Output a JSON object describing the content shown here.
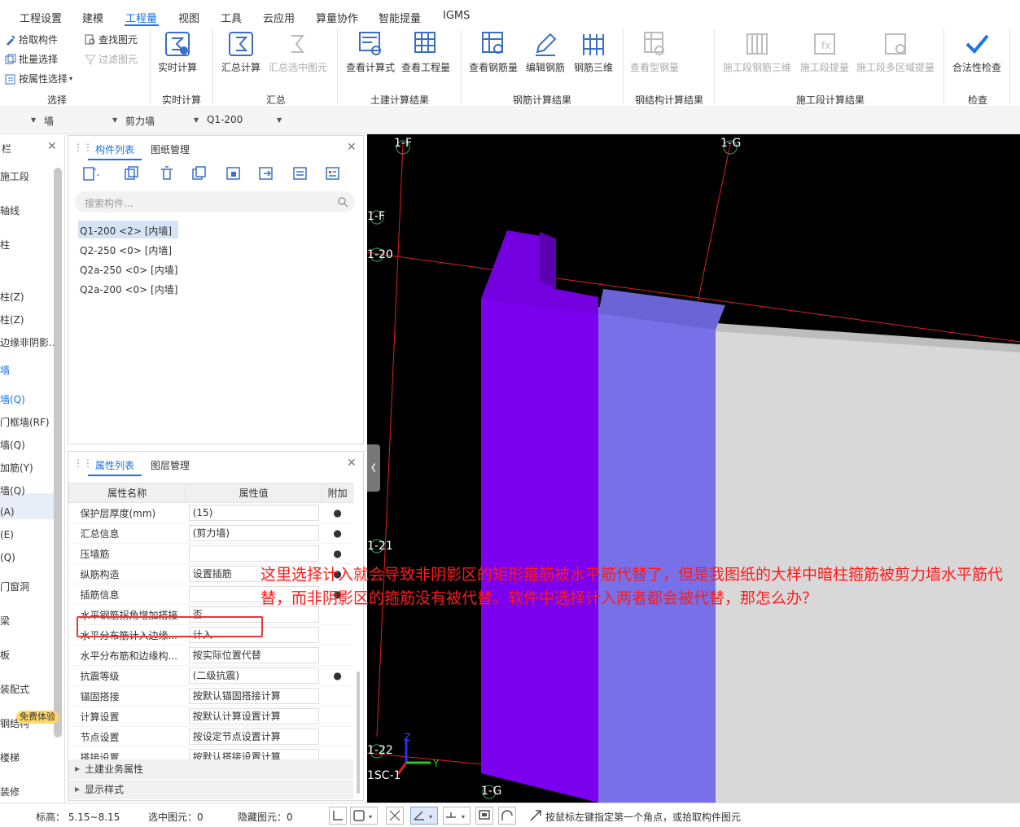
{
  "menu": {
    "items": [
      "工程设置",
      "建模",
      "工程量",
      "视图",
      "工具",
      "云应用",
      "算量协作",
      "智能提量",
      "IGMS"
    ],
    "active": "工程量"
  },
  "ribbon": {
    "select_group": {
      "label": "选择",
      "pick": "拾取构件",
      "batch": "批量选择",
      "by_attr": "按属性选择",
      "find": "查找图元",
      "filter": "过滤图元"
    },
    "realtime_group": {
      "label": "实时计算",
      "button": "实时计算"
    },
    "sum_group": {
      "label": "汇总",
      "sum": "汇总计算",
      "sum_selected": "汇总选中图元"
    },
    "civil_group": {
      "label": "土建计算结果",
      "view_formula": "查看计算式",
      "view_quantity": "查看工程量"
    },
    "rebar_group": {
      "label": "钢筋计算结果",
      "view_rebar": "查看钢筋量",
      "edit_rebar": "编辑钢筋",
      "rebar_3d": "钢筋三维"
    },
    "steel_group": {
      "label": "钢结构计算结果",
      "view_steel": "查看型钢量"
    },
    "stage_group": {
      "label": "施工段计算结果",
      "stage_rebar_3d": "施工段钢筋三维",
      "stage_extract": "施工段提量",
      "stage_multi": "施工段多区域提量"
    },
    "check_group": {
      "label": "检查",
      "legality": "合法性检查"
    }
  },
  "selectors": {
    "floor": "",
    "type": "墙",
    "subtype": "剪力墙",
    "component": "Q1-200"
  },
  "leftnav": {
    "header": "栏",
    "items": [
      "施工段",
      "轴线",
      "柱",
      "柱(Z)",
      "柱(Z)",
      "边缘非阴影...",
      "墙",
      "墙(Q)",
      "门框墙(RF)",
      "墙(Q)",
      "加筋(Y)",
      "墙(Q)",
      "(A)",
      "(E)",
      "(Q)",
      "门窗洞",
      "梁",
      "板",
      "装配式",
      "钢结构",
      "楼梯",
      "装修"
    ],
    "active": "墙",
    "badge": "免费体验"
  },
  "component_panel": {
    "tabs": [
      "构件列表",
      "图纸管理"
    ],
    "search_placeholder": "搜索构件...",
    "items": [
      "Q1-200 <2> [内墙]",
      "Q2-250 <0> [内墙]",
      "Q2a-250 <0> [内墙]",
      "Q2a-200 <0> [内墙]"
    ],
    "selected_index": 0
  },
  "property_panel": {
    "tabs": [
      "属性列表",
      "图层管理"
    ],
    "headers": {
      "name": "属性名称",
      "value": "属性值",
      "extra": "附加"
    },
    "rows": [
      {
        "name": "保护层厚度(mm)",
        "value": "(15)",
        "extra": true
      },
      {
        "name": "汇总信息",
        "value": "(剪力墙)",
        "extra": true
      },
      {
        "name": "压墙筋",
        "value": "",
        "extra": true
      },
      {
        "name": "纵筋构造",
        "value": "设置插筋",
        "extra": true
      },
      {
        "name": "插筋信息",
        "value": "",
        "extra": true
      },
      {
        "name": "水平钢筋拐角增加搭接",
        "value": "否",
        "extra": false
      },
      {
        "name": "水平分布筋计入边缘...",
        "value": "计入",
        "extra": false
      },
      {
        "name": "水平分布筋和边缘构...",
        "value": "按实际位置代替",
        "extra": false
      },
      {
        "name": "抗震等级",
        "value": "(二级抗震)",
        "extra": true
      },
      {
        "name": "锚固搭接",
        "value": "按默认锚固搭接计算",
        "extra": false
      },
      {
        "name": "计算设置",
        "value": "按默认计算设置计算",
        "extra": false
      },
      {
        "name": "节点设置",
        "value": "按设定节点设置计算",
        "extra": false
      },
      {
        "name": "搭接设置",
        "value": "按默认搭接设置计算",
        "extra": false
      }
    ],
    "groups": [
      "土建业务属性",
      "显示样式"
    ]
  },
  "viewport": {
    "axes": [
      "1-F",
      "1-G",
      "1-F",
      "1-20",
      "1-21",
      "1-22",
      "1SC-1",
      "1-G"
    ],
    "gizmo": {
      "z": "Z",
      "y": "Y"
    },
    "colors": {
      "wall_purple": "#7a00ee",
      "wall_blue": "#7870e8",
      "slab_gray": "#d8d8d8",
      "axis_line": "#e02020"
    }
  },
  "annotation": "这里选择计入就会导致非阴影区的矩形箍筋被水平筋代替了，但是我图纸的大样中暗柱箍筋被剪力墙水平筋代替，而非阴影区的箍筋没有被代替。软件中选择计入两者都会被代替，那怎么办？",
  "statusbar": {
    "elevation": "标高：  5.15~8.15",
    "selected": "选中图元：0",
    "hidden": "隐藏图元：0",
    "hint": "按鼠标左键指定第一个角点，或拾取构件图元"
  }
}
